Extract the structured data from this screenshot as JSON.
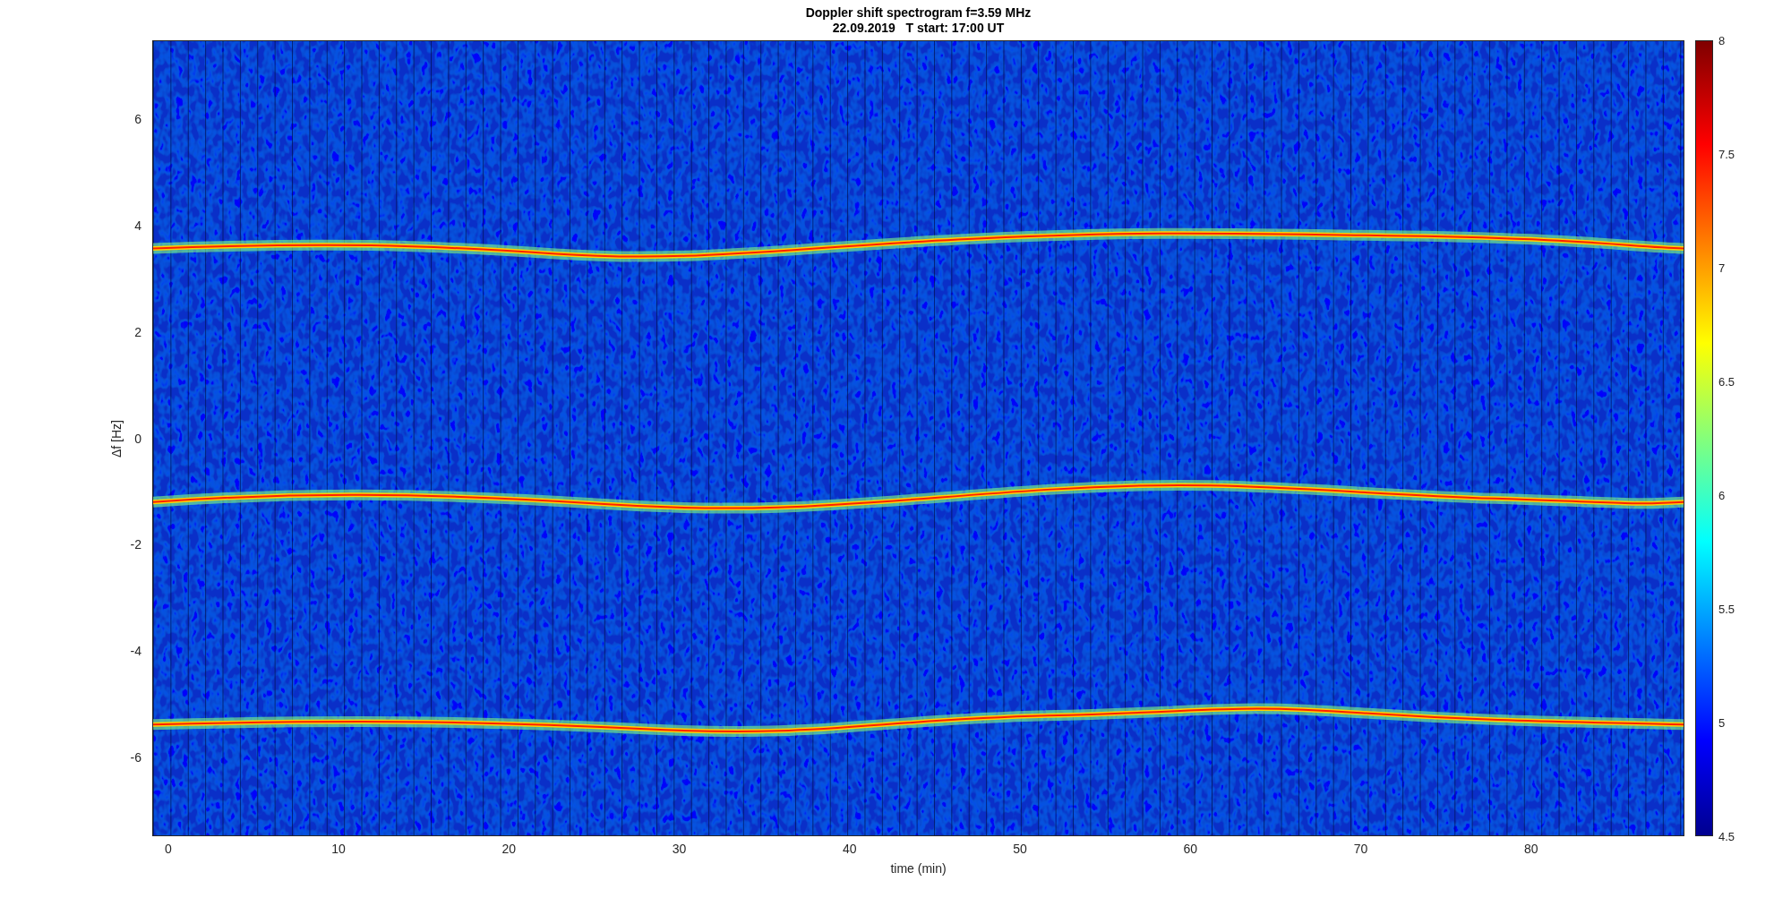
{
  "title": {
    "line_1": "Doppler shift spectrogram f=3.59 MHz",
    "line_2": "22.09.2019   T start: 17:00 UT"
  },
  "y_axis": {
    "label": "Δf [Hz]",
    "ticks": [
      "6",
      "4",
      "2",
      "0",
      "-2",
      "-4",
      "-6"
    ]
  },
  "x_axis": {
    "label": "time (min)",
    "ticks": [
      "0",
      "10",
      "20",
      "30",
      "40",
      "50",
      "60",
      "70",
      "80"
    ]
  },
  "colorbar": {
    "ticks": [
      "8",
      "7.5",
      "7",
      "6.5",
      "6",
      "5.5",
      "5",
      "4.5"
    ]
  }
}
